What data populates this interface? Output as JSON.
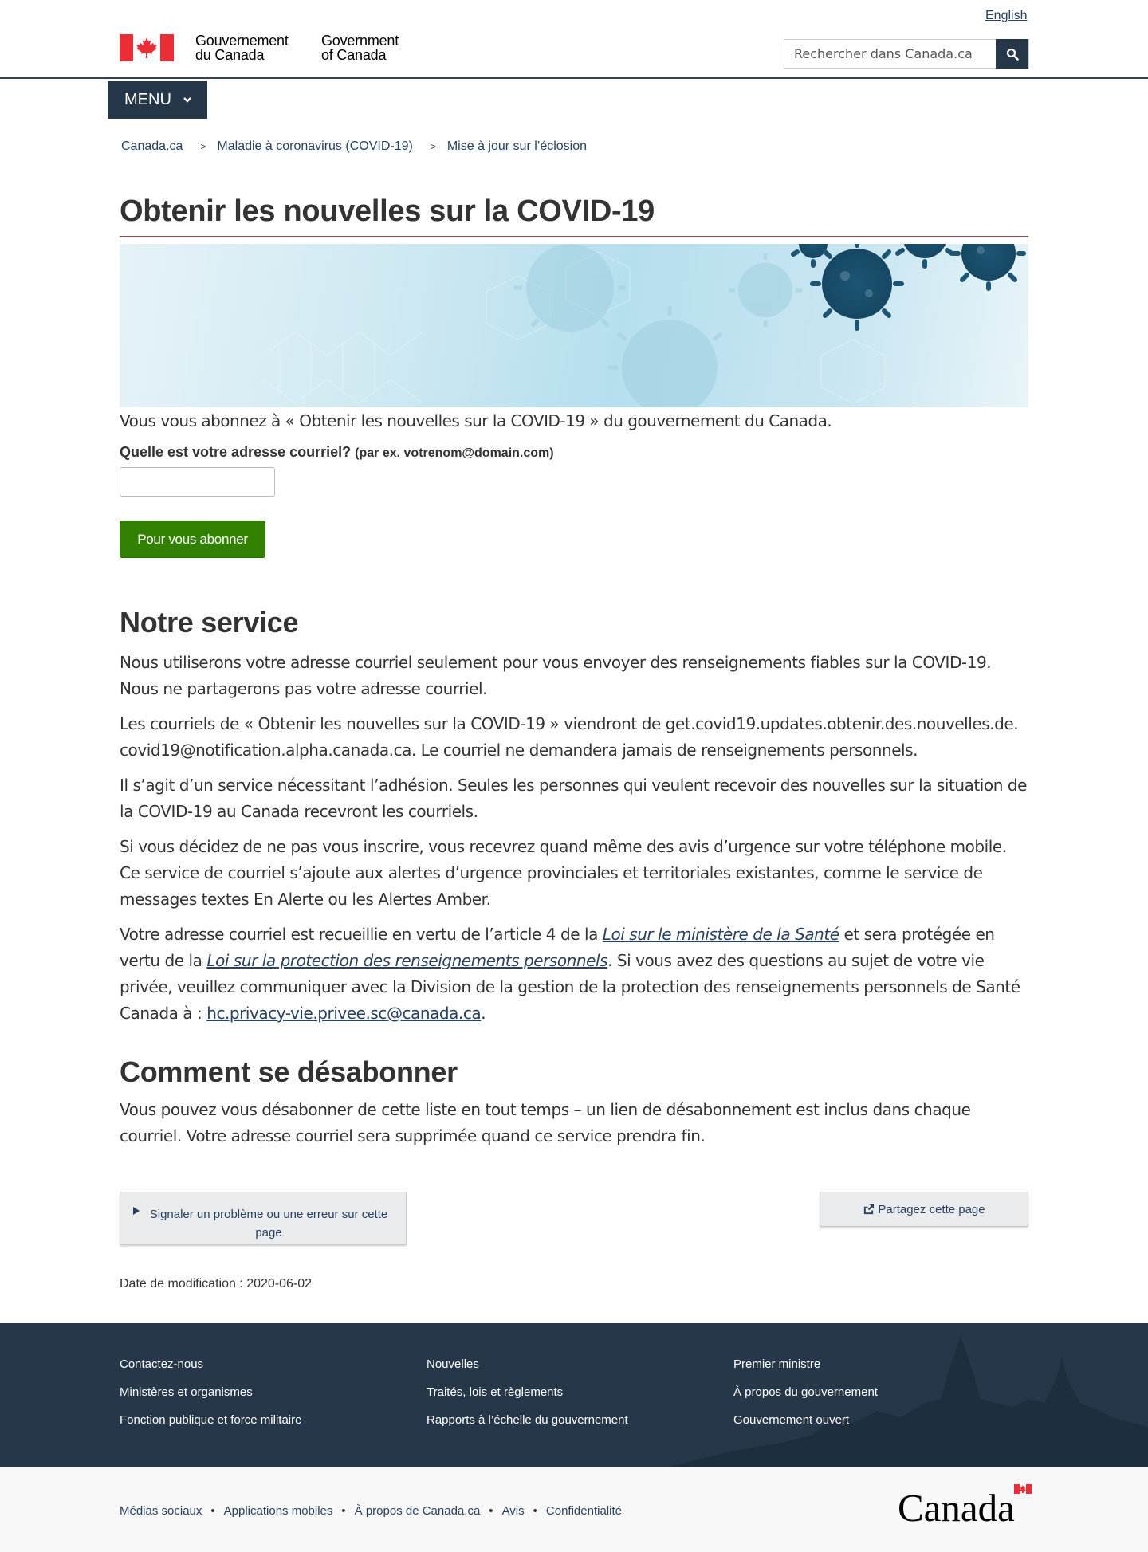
{
  "header": {
    "lang_link": "English",
    "signature_fr_line1": "Gouvernement",
    "signature_fr_line2": "du Canada",
    "signature_en_line1": "Government",
    "signature_en_line2": "of Canada",
    "search_placeholder": "Rechercher dans Canada.ca",
    "menu_label": "MENU"
  },
  "breadcrumb": [
    "Canada.ca",
    "Maladie à coronavirus (COVID-19)",
    "Mise à jour sur l’éclosion"
  ],
  "breadcrumb_separator": ">",
  "main": {
    "title": "Obtenir les nouvelles sur la COVID-19",
    "intro": "Vous vous abonnez à « Obtenir les nouvelles sur la COVID-19 » du gouvernement du Canada.",
    "email_label": "Quelle est votre adresse courriel?",
    "email_label_hint": "(par ex. votrenom@domain.com)",
    "email_value": "",
    "subscribe_label": "Pour vous abonner",
    "service_heading": "Notre service",
    "p1": "Nous utiliserons votre adresse courriel seulement pour vous envoyer des renseignements fiables sur la COVID-19. Nous ne partagerons pas votre adresse courriel.",
    "p2_line1": "Les courriels de « Obtenir les nouvelles sur la COVID-19 » viendront de get.covid19.updates.obtenir.des.nouvelles.de.",
    "p2_line2": "covid19@notification.alpha.canada.ca. Le courriel ne demandera jamais de renseignements personnels.",
    "p3": "Il s’agit d’un service nécessitant l’adhésion. Seules les personnes qui veulent recevoir des nouvelles sur la situation de la COVID-19 au Canada recevront les courriels.",
    "p4": "Si vous décidez de ne pas vous inscrire, vous recevrez quand même des avis d’urgence sur votre téléphone mobile. Ce service de courriel s’ajoute aux alertes d’urgence provinciales et territoriales existantes, comme le service de messages textes En Alerte ou les Alertes Amber.",
    "p5_a": "Votre adresse courriel est recueillie en vertu de l’article 4 de la ",
    "p5_link1": "Loi sur le ministère de la Santé",
    "p5_b": " et sera protégée en vertu de la ",
    "p5_link2": "Loi sur la protection des renseignements personnels",
    "p5_c": ". Si vous avez des questions au sujet de votre vie privée, veuillez communiquer avec la Division de la gestion de la protection des renseignements personnels de Santé Canada à : ",
    "p5_email": "hc.privacy-vie.privee.sc@canada.ca",
    "p5_d": ".",
    "unsub_heading": "Comment se désabonner",
    "p6": "Vous pouvez vous désabonner de cette liste en tout temps – un lien de désabonnement est inclus dans chaque courriel. Votre adresse courriel sera supprimée quand ce service prendra fin.",
    "report_label": "Signaler un problème ou une erreur sur cette page",
    "share_label": "Partagez cette page",
    "date_modified": "Date de modification : 2020-06-02"
  },
  "footer": {
    "col1": [
      "Contactez-nous",
      "Ministères et organismes",
      "Fonction publique et force militaire"
    ],
    "col2": [
      "Nouvelles",
      "Traités, lois et règlements",
      "Rapports à l’échelle du gouvernement"
    ],
    "col3": [
      "Premier ministre",
      "À propos du gouvernement",
      "Gouvernement ouvert"
    ],
    "sub_links": [
      "Médias sociaux",
      "Applications mobiles",
      "À propos de Canada.ca",
      "Avis",
      "Confidentialité"
    ],
    "sub_separator": "•",
    "wordmark": "Canada"
  },
  "colors": {
    "header_dark": "#26374a",
    "link": "#284162",
    "flag_red": "#eb2d37",
    "subscribe_green": "#318000",
    "title_rule": "#af3c43"
  },
  "icons": [
    "maple-leaf-icon",
    "search-icon",
    "chevron-down-icon",
    "triangle-right-icon",
    "share-icon"
  ]
}
